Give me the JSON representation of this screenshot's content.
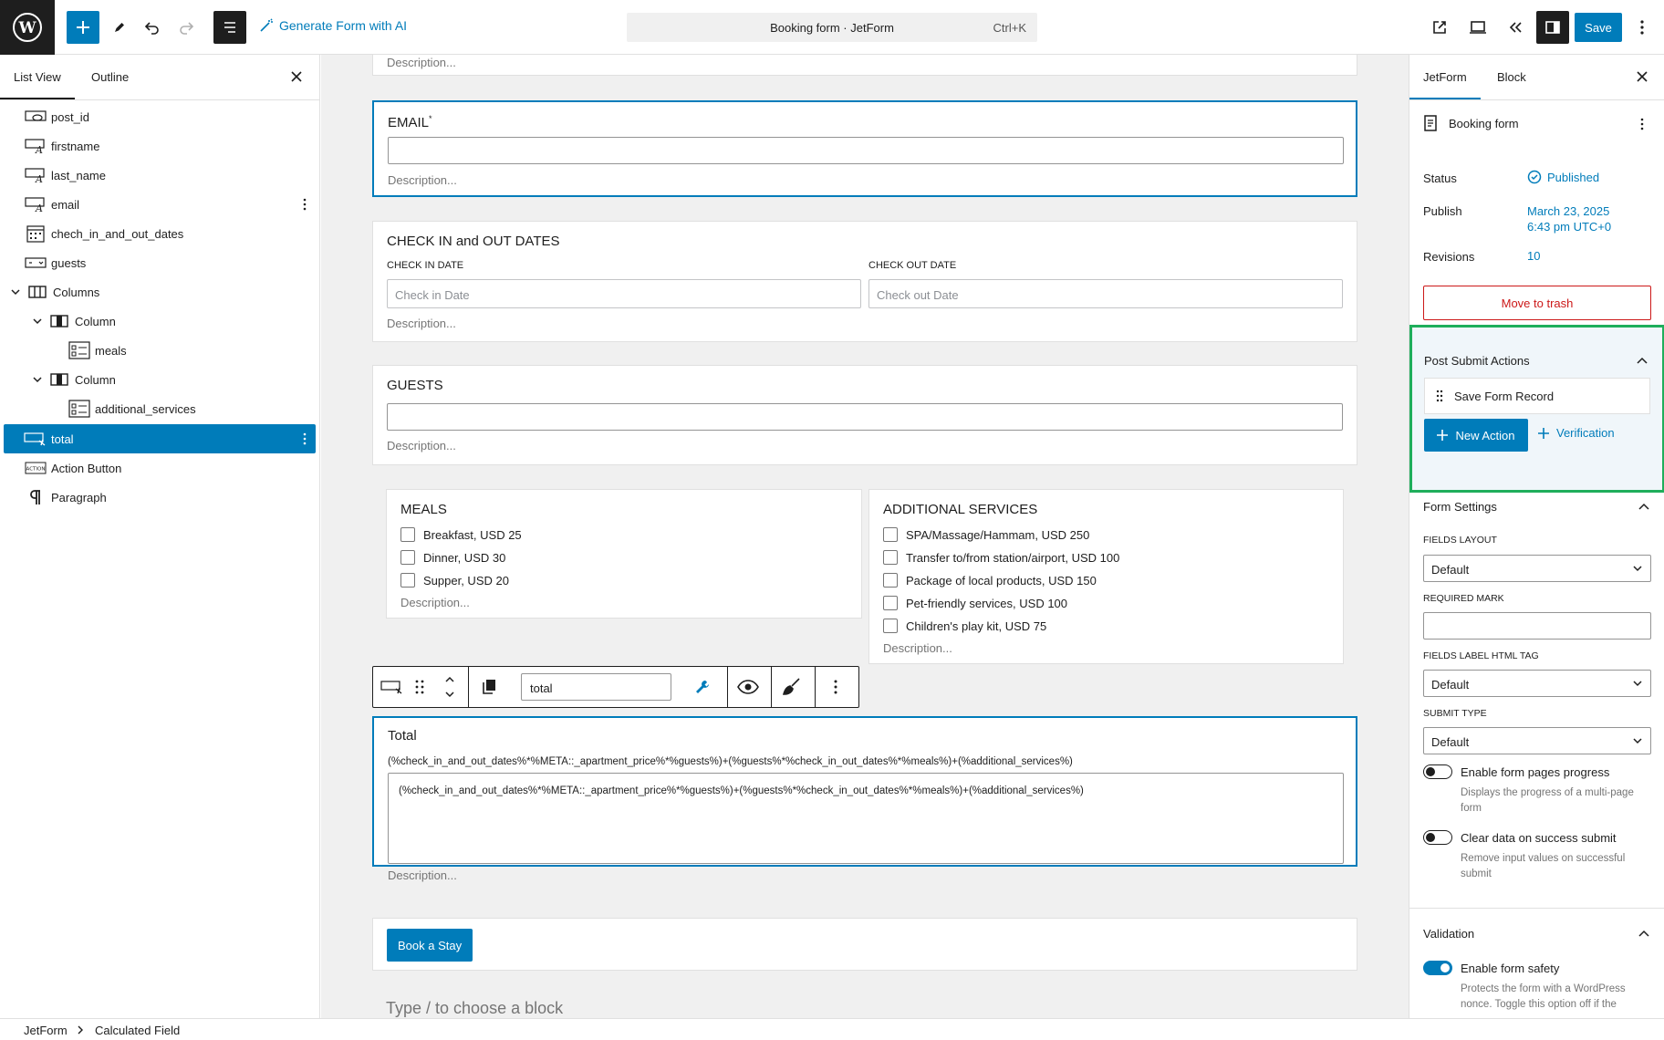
{
  "topbar": {
    "generate_ai_label": "Generate Form with AI",
    "doc_title": "Booking form · JetForm",
    "shortcut": "Ctrl+K",
    "save_label": "Save"
  },
  "left_panel": {
    "tabs": [
      "List View",
      "Outline"
    ],
    "items": [
      {
        "label": "post_id",
        "icon": "hidden-field-icon"
      },
      {
        "label": "firstname",
        "icon": "text-field-icon"
      },
      {
        "label": "last_name",
        "icon": "text-field-icon"
      },
      {
        "label": "email",
        "icon": "text-field-icon"
      },
      {
        "label": "chech_in_and_out_dates",
        "icon": "calendar-icon"
      },
      {
        "label": "guests",
        "icon": "number-field-icon"
      },
      {
        "label": "Columns",
        "icon": "columns-icon"
      },
      {
        "label": "Column",
        "icon": "column-icon"
      },
      {
        "label": "meals",
        "icon": "checkbox-field-icon"
      },
      {
        "label": "Column",
        "icon": "column-icon"
      },
      {
        "label": "additional_services",
        "icon": "checkbox-field-icon"
      },
      {
        "label": "total",
        "icon": "calculated-field-icon"
      },
      {
        "label": "Action Button",
        "icon": "action-button-icon"
      },
      {
        "label": "Paragraph",
        "icon": "paragraph-icon"
      }
    ],
    "action_badge": "ACTION"
  },
  "canvas": {
    "top_desc": "Description...",
    "email": {
      "label": "EMAIL",
      "required_mark": "*",
      "desc": "Description..."
    },
    "dates": {
      "label": "CHECK IN and OUT DATES",
      "check_in_label": "CHECK IN DATE",
      "check_in_placeholder": "Check in Date",
      "check_out_label": "CHECK OUT DATE",
      "check_out_placeholder": "Check out Date",
      "desc": "Description..."
    },
    "guests": {
      "label": "GUESTS",
      "desc": "Description..."
    },
    "meals": {
      "label": "MEALS",
      "options": [
        "Breakfast, USD 25",
        "Dinner, USD 30",
        "Supper, USD 20"
      ],
      "desc": "Description..."
    },
    "services": {
      "label": "ADDITIONAL SERVICES",
      "options": [
        "SPA/Massage/Hammam, USD 250",
        "Transfer to/from station/airport, USD 100",
        "Package of local products, USD 150",
        "Pet-friendly services, USD 100",
        "Children's play kit, USD 75"
      ],
      "desc": "Description..."
    },
    "toolbar": {
      "name_value": "total"
    },
    "total": {
      "label": "Total",
      "formula": "(%check_in_and_out_dates%*%META::_apartment_price%*%guests%)+(%guests%*%check_in_out_dates%*%meals%)+(%additional_services%)",
      "formula_value": "(%check_in_and_out_dates%*%META::_apartment_price%*%guests%)+(%guests%*%check_in_out_dates%*%meals%)+(%additional_services%)",
      "desc": "Description..."
    },
    "book_button": "Book a Stay",
    "type_hint": "Type / to choose a block"
  },
  "footer": {
    "crumbs": [
      "JetForm",
      "Calculated Field"
    ]
  },
  "right_panel": {
    "tabs": [
      "JetForm",
      "Block"
    ],
    "form_name": "Booking form",
    "status_label": "Status",
    "status_value": "Published",
    "publish_label": "Publish",
    "publish_date": "March 23, 2025",
    "publish_time": "6:43 pm UTC+0",
    "revisions_label": "Revisions",
    "revisions_value": "10",
    "trash_label": "Move to trash",
    "psa_title": "Post Submit Actions",
    "psa_action": "Save Form Record",
    "new_action_label": "New Action",
    "verification_label": "Verification",
    "form_settings_title": "Form Settings",
    "fields_layout_label": "FIELDS LAYOUT",
    "fields_layout_value": "Default",
    "required_mark_label": "REQUIRED MARK",
    "label_tag_label": "FIELDS LABEL HTML TAG",
    "label_tag_value": "Default",
    "submit_type_label": "SUBMIT TYPE",
    "submit_type_value": "Default",
    "pages_progress_label": "Enable form pages progress",
    "pages_progress_help": "Displays the progress of a multi-page form",
    "clear_data_label": "Clear data on success submit",
    "clear_data_help": "Remove input values on successful submit",
    "validation_title": "Validation",
    "safety_label": "Enable form safety",
    "safety_help": "Protects the form with a WordPress nonce. Toggle this option off if the"
  },
  "colors": {
    "accent": "#007cba",
    "highlight_box": "#1fae5b",
    "danger": "#cc1818"
  }
}
